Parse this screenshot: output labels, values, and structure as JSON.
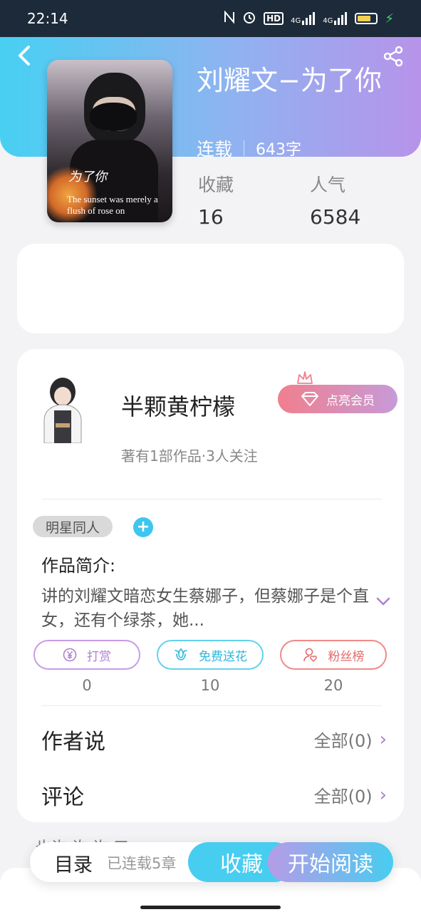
{
  "status_bar": {
    "time": "22:14",
    "icons": [
      "nfc-icon",
      "alarm-icon",
      "hd-icon",
      "signal-4g-icon",
      "signal-4g-icon-2",
      "battery-icon",
      "charging-icon"
    ],
    "hd_label": "HD",
    "net_label_1": "4G",
    "net_label_2": "4G"
  },
  "header": {
    "back_icon": "chevron-left-icon",
    "share_icon": "share-icon",
    "gradient": [
      "#47d0f2",
      "#b793ea"
    ]
  },
  "book": {
    "title": "刘耀文−为了你",
    "status": "连载",
    "word_count": "643字",
    "cover_title": "为了你",
    "cover_text": "The sunset was merely a flush of rose on",
    "stats": [
      {
        "label": "收藏",
        "value": "16"
      },
      {
        "label": "人气",
        "value": "6584"
      }
    ]
  },
  "author": {
    "name": "半颗黄柠檬",
    "info": "著有1部作品·3人关注",
    "vip_button": "点亮会员"
  },
  "tags": {
    "items": [
      "明星同人"
    ],
    "add_label": "+"
  },
  "intro": {
    "title": "作品简介:",
    "text": "讲的刘耀文暗恋女生蔡娜子，但蔡娜子是个直女，还有个绿茶，她..."
  },
  "actions": [
    {
      "label": "打赏",
      "count": "0",
      "icon": "yen-icon"
    },
    {
      "label": "免费送花",
      "count": "10",
      "icon": "flower-icon"
    },
    {
      "label": "粉丝榜",
      "count": "20",
      "icon": "user-heart-icon"
    }
  ],
  "rows": [
    {
      "label": "作者说",
      "right": "全部(0)"
    },
    {
      "label": "评论",
      "right": "全部(0)"
    }
  ],
  "partial_below": "也许 许 许 三",
  "bottom_bar": {
    "toc": "目录",
    "chapters": "已连载5章",
    "favorite": "收藏",
    "read": "开始阅读"
  },
  "colors": {
    "accent_cyan": "#47cdf0",
    "accent_purple": "#b79be8",
    "vip_pink": "#f07f8e"
  }
}
